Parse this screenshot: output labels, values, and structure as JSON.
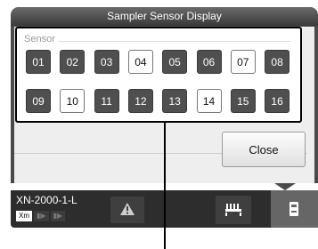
{
  "dialog": {
    "title": "Sampler Sensor Display",
    "sensor_group_label": "Sensor",
    "sensors": [
      {
        "label": "01",
        "state": "off"
      },
      {
        "label": "02",
        "state": "off"
      },
      {
        "label": "03",
        "state": "off"
      },
      {
        "label": "04",
        "state": "on"
      },
      {
        "label": "05",
        "state": "off"
      },
      {
        "label": "06",
        "state": "off"
      },
      {
        "label": "07",
        "state": "on"
      },
      {
        "label": "08",
        "state": "off"
      },
      {
        "label": "09",
        "state": "off"
      },
      {
        "label": "10",
        "state": "on"
      },
      {
        "label": "11",
        "state": "off"
      },
      {
        "label": "12",
        "state": "off"
      },
      {
        "label": "13",
        "state": "off"
      },
      {
        "label": "14",
        "state": "on"
      },
      {
        "label": "15",
        "state": "off"
      },
      {
        "label": "16",
        "state": "off"
      }
    ],
    "close_label": "Close"
  },
  "statusbar": {
    "model_name": "XN-2000-1-L",
    "model_tab_active": "Xm",
    "icons": {
      "warning": "warning-triangle-icon",
      "rack": "sampler-rack-icon",
      "device": "device-icon"
    }
  },
  "colors": {
    "sensor_off": "#4f4f4f",
    "sensor_on": "#ffffff",
    "title_bar": "#4a4a4a",
    "status_bar": "#2d2d2d"
  }
}
